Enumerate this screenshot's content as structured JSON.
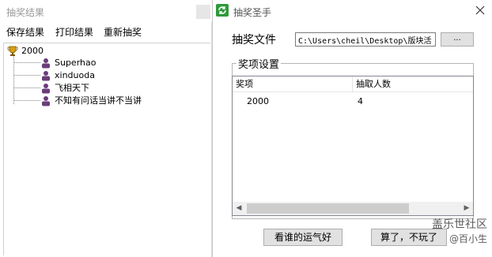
{
  "back_window": {
    "title": "抽奖结果",
    "menu": [
      "保存结果",
      "打印结果",
      "重新抽奖"
    ],
    "tree": {
      "root": "2000",
      "winners": [
        "Superhao",
        "xinduoda",
        "飞相天下",
        "不知有问话当讲不当讲"
      ]
    }
  },
  "dialog": {
    "title": "抽奖圣手",
    "file_label": "抽奖文件",
    "file_path": "C:\\Users\\cheil\\Desktop\\版块活",
    "browse_label": "...",
    "group_label": "奖项设置",
    "columns": [
      "奖项",
      "抽取人数"
    ],
    "rows": [
      [
        "2000",
        "4"
      ]
    ],
    "btn_luck": "看谁的运气好",
    "btn_quit": "算了，不玩了"
  },
  "watermark": {
    "line1": "盖乐世社区",
    "line2": "@百小生"
  },
  "colors": {
    "accent_green": "#2e9a3a",
    "trophy_gold": "#d4a017",
    "person_purple": "#6b3d7a"
  }
}
